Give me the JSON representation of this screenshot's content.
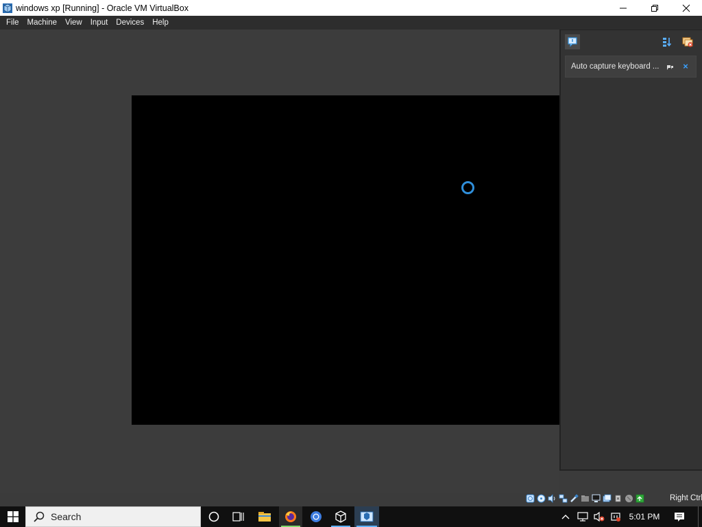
{
  "window": {
    "title": "windows xp [Running] - Oracle VM VirtualBox"
  },
  "menu": {
    "items": [
      "File",
      "Machine",
      "View",
      "Input",
      "Devices",
      "Help"
    ]
  },
  "notification_panel": {
    "notification_text": "Auto capture keyboard ...",
    "close_glyph": "×"
  },
  "status_bar": {
    "icons": [
      "hard-disk-icon",
      "optical-drive-icon",
      "audio-icon",
      "network-icon",
      "usb-icon",
      "shared-folders-icon",
      "display-icon",
      "recording-icon",
      "cpu-icon",
      "mouse-integration-icon",
      "keyboard-icon"
    ],
    "host_key_text": "Right Ctrl"
  },
  "taskbar": {
    "search_text": "Search",
    "pinned_apps": [
      "file-explorer",
      "firefox",
      "chrome",
      "virtualbox-manager",
      "virtualbox-vm"
    ],
    "clock": "5:01 PM"
  },
  "colors": {
    "accent": "#2f8fdb",
    "menubar": "#2d2d2d",
    "vm_background": "#3c3c3c",
    "taskbar": "#101010"
  }
}
